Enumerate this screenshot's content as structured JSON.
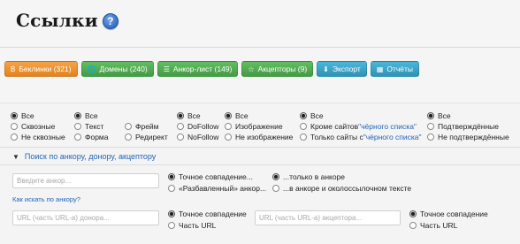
{
  "page": {
    "title": "Ссылки",
    "help_icon": "question-icon"
  },
  "tabs": [
    {
      "label": "Беклинки (321)",
      "icon": "b-icon",
      "color": "#f0952f"
    },
    {
      "label": "Домены (240)",
      "icon": "globe-icon",
      "color": "#56ad56"
    },
    {
      "label": "Анкор-лист (149)",
      "icon": "list-icon",
      "color": "#56ad56"
    },
    {
      "label": "Акцепторы (9)",
      "icon": "star-icon",
      "color": "#56ad56"
    },
    {
      "label": "Экспорт",
      "icon": "download-icon",
      "color": "#3ea5c8"
    },
    {
      "label": "Отчёты",
      "icon": "reports-icon",
      "color": "#3ea5c8"
    }
  ],
  "filters": {
    "group1": [
      "Все",
      "Сквозные",
      "Не сквозные"
    ],
    "group2": [
      "Все",
      "Текст",
      "Форма"
    ],
    "group3": [
      "Фрейм",
      "Редирект"
    ],
    "group4": [
      "Все",
      "DoFollow",
      "NoFollow"
    ],
    "group5": [
      "Все",
      "Изображение",
      "Не изображение"
    ],
    "group6": {
      "all": "Все",
      "except_prefix": "Кроме сайтов ",
      "only_prefix": "Только сайты с ",
      "blacklist_link": "\"чёрного списка\""
    },
    "group7": [
      "Все",
      "Подтверждённые",
      "Не подтверждённые"
    ]
  },
  "search": {
    "toggle_label": "Поиск по анкору, донору, акцептору",
    "anchor_placeholder": "Введите анкор...",
    "anchor_match": [
      "Точное совпадение...",
      "«Разбавленный» анкор..."
    ],
    "anchor_scope": [
      "...только в анкоре",
      "...в анкоре и околоссылочном тексте"
    ],
    "how_to_link": "Как искать по анкору?",
    "donor_placeholder": "URL (часть URL-а) донора...",
    "donor_match": [
      "Точное совпадение",
      "Часть URL"
    ],
    "acceptor_placeholder": "URL (часть URL-а) акцептора...",
    "acceptor_match": [
      "Точное совпадение",
      "Часть URL"
    ]
  }
}
